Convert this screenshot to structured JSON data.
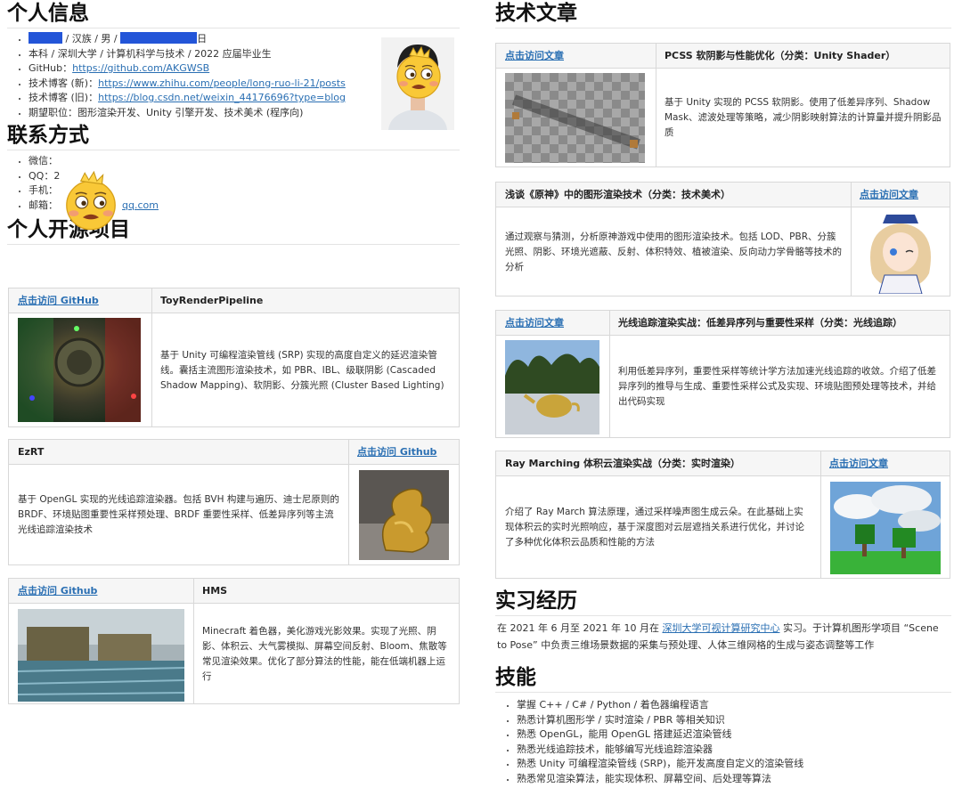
{
  "profile": {
    "heading": "个人信息",
    "line1_mid": "/ 汉族 / 男 /",
    "line1_end": "日",
    "items": [
      "本科 / 深圳大学 / 计算机科学与技术 / 2022 应届毕业生",
      "期望职位：图形渲染开发、Unity 引擎开发、技术美术 (程序向)"
    ],
    "github_label": "GitHub：",
    "github_url": "https://github.com/AKGWSB",
    "blog_new_label": "技术博客 (新)：",
    "blog_new_url": "https://www.zhihu.com/people/long-ruo-li-21/posts",
    "blog_old_label": "技术博客 (旧)：",
    "blog_old_url": "https://blog.csdn.net/weixin_44176696?type=blog"
  },
  "contact": {
    "heading": "联系方式",
    "wechat": "微信：",
    "qq": "QQ：",
    "qq_tail": "2",
    "phone": "手机：",
    "email": "邮箱：",
    "email_tail": "qq.com"
  },
  "projects": {
    "heading": "个人开源项目",
    "list": [
      {
        "link": "点击访问 GitHub",
        "title": "ToyRenderPipeline",
        "desc": "基于 Unity 可编程渲染管线 (SRP) 实现的高度自定义的延迟渲染管线。囊括主流图形渲染技术，如 PBR、IBL、级联阴影 (Cascaded Shadow Mapping)、软阴影、分簇光照 (Cluster Based Lighting)"
      },
      {
        "link": "点击访问 Github",
        "title": "EzRT",
        "desc": "基于 OpenGL 实现的光线追踪渲染器。包括 BVH 构建与遍历、迪士尼原则的 BRDF、环境贴图重要性采样预处理、BRDF 重要性采样、低差异序列等主流光线追踪渲染技术"
      },
      {
        "link": "点击访问 Github",
        "title": "HMS",
        "desc": "Minecraft 着色器，美化游戏光影效果。实现了光照、阴影、体积云、大气雾模拟、屏幕空间反射、Bloom、焦散等常见渲染效果。优化了部分算法的性能，能在低端机器上运行"
      }
    ]
  },
  "articles": {
    "heading": "技术文章",
    "list": [
      {
        "link": "点击访问文章",
        "title": "PCSS 软阴影与性能优化（分类：Unity Shader）",
        "desc": "基于 Unity 实现的 PCSS 软阴影。使用了低差异序列、Shadow Mask、滤波处理等策略，减少阴影映射算法的计算量并提升阴影品质"
      },
      {
        "link": "点击访问文章",
        "title": "浅谈《原神》中的图形渲染技术（分类：技术美术）",
        "desc": "通过观察与猜测，分析原神游戏中使用的图形渲染技术。包括 LOD、PBR、分簇光照、阴影、环境光遮蔽、反射、体积特效、植被渲染、反向动力学骨骼等技术的分析"
      },
      {
        "link": "点击访问文章",
        "title": "光线追踪渲染实战：低差异序列与重要性采样（分类：光线追踪）",
        "desc": "利用低差异序列，重要性采样等统计学方法加速光线追踪的收敛。介绍了低差异序列的推导与生成、重要性采样公式及实现、环境贴图预处理等技术，并给出代码实现"
      },
      {
        "link": "点击访问文章",
        "title": "Ray Marching 体积云渲染实战（分类：实时渲染）",
        "desc": "介绍了 Ray March 算法原理，通过采样噪声图生成云朵。在此基础上实现体积云的实时光照响应，基于深度图对云层遮挡关系进行优化，并讨论了多种优化体积云品质和性能的方法"
      }
    ]
  },
  "internship": {
    "heading": "实习经历",
    "pre": "在 2021 年 6 月至 2021 年 10 月在",
    "org": "深圳大学可视计算研究中心",
    "post": "实习。于计算机图形学项目 “Scene to Pose” 中负责三维场景数据的采集与预处理、人体三维网格的生成与姿态调整等工作"
  },
  "skills": {
    "heading": "技能",
    "items": [
      "掌握 C++ / C# / Python / 着色器编程语言",
      "熟悉计算机图形学 / 实时渲染 / PBR 等相关知识",
      "熟悉 OpenGL，能用 OpenGL 搭建延迟渲染管线",
      "熟悉光线追踪技术，能够编写光线追踪渲染器",
      "熟悉 Unity 可编程渲染管线 (SRP)，能开发高度自定义的渲染管线",
      "熟悉常见渲染算法，能实现体积、屏幕空间、后处理等算法"
    ]
  },
  "colors": {
    "link": "#2a6fb3",
    "redaction": "#2355d8",
    "border": "#d8d8d8"
  }
}
